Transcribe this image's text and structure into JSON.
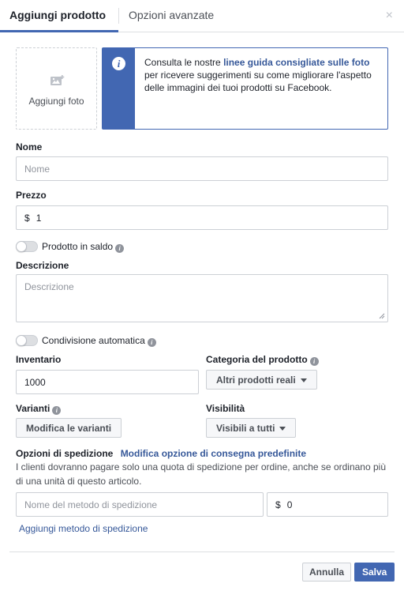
{
  "tabs": [
    {
      "label": "Aggiungi prodotto",
      "active": true
    },
    {
      "label": "Opzioni avanzate",
      "active": false
    }
  ],
  "close_glyph": "×",
  "photo": {
    "label": "Aggiungi foto",
    "icon": "add-photo-icon"
  },
  "info": {
    "icon_glyph": "i",
    "text_before": "Consulta le nostre ",
    "link": "linee guida consigliate sulle foto",
    "text_after": " per ricevere suggerimenti su come migliorare l'aspetto delle immagini dei tuoi prodotti su Facebook."
  },
  "name": {
    "label": "Nome",
    "placeholder": "Nome",
    "value": ""
  },
  "price": {
    "label": "Prezzo",
    "currency": "$",
    "value": "1"
  },
  "sale_toggle": {
    "label": "Prodotto in saldo",
    "on": false
  },
  "description": {
    "label": "Descrizione",
    "placeholder": "Descrizione",
    "value": ""
  },
  "auto_share_toggle": {
    "label": "Condivisione automatica",
    "on": false
  },
  "inventory": {
    "label": "Inventario",
    "value": "1000"
  },
  "category": {
    "label": "Categoria del prodotto",
    "selected": "Altri prodotti reali"
  },
  "variants": {
    "label": "Varianti",
    "button": "Modifica le varianti"
  },
  "visibility": {
    "label": "Visibilità",
    "selected": "Visibili a tutti"
  },
  "shipping": {
    "label": "Opzioni di spedizione",
    "edit_link": "Modifica opzione di consegna predefinite",
    "help": "I clienti dovranno pagare solo una quota di spedizione per ordine, anche se ordinano più di una unità di questo articolo.",
    "method_placeholder": "Nome del metodo di spedizione",
    "currency": "$",
    "cost": "0",
    "add_link": "Aggiungi metodo di spedizione"
  },
  "footer": {
    "cancel": "Annulla",
    "save": "Salva"
  },
  "help_glyph": "i",
  "colors": {
    "accent": "#4267b2",
    "link": "#365899",
    "border": "#ccd0d5"
  }
}
